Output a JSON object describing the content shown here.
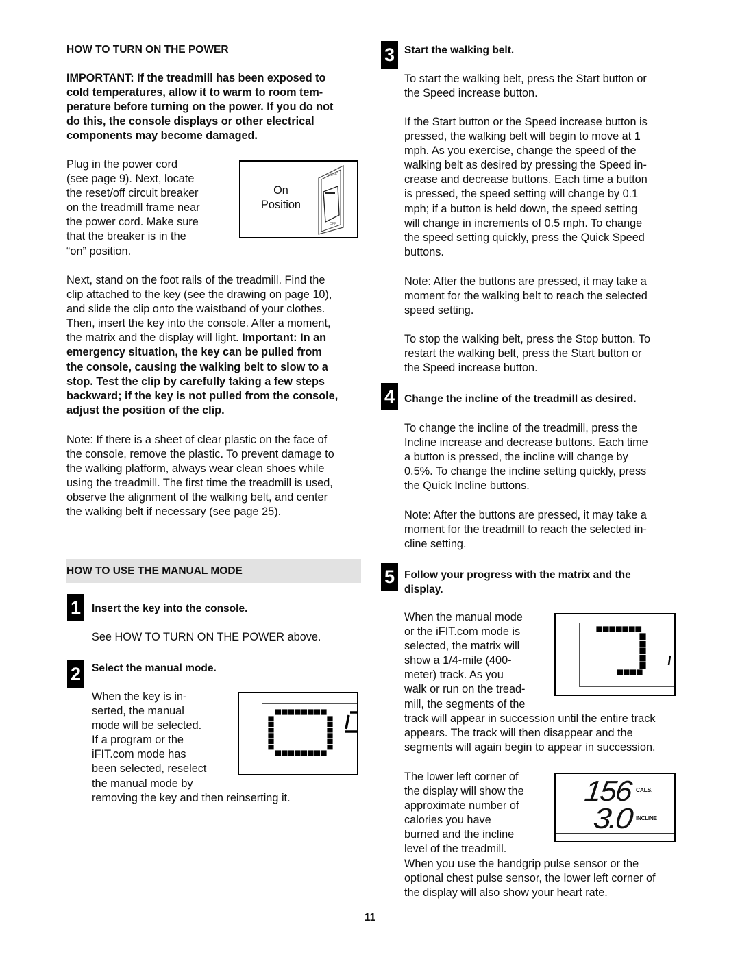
{
  "left": {
    "power_heading": "HOW TO TURN ON THE POWER",
    "important": "IMPORTANT: If the treadmill has been exposed to\ncold temperatures, allow it to warm to room tem-\nperature before turning on the power. If you do not\ndo this, the console displays or other electrical\ncomponents may become damaged.",
    "plug": "Plug in the power cord\n(see page 9). Next, locate\nthe reset/off circuit breaker\non the treadmill frame near\nthe power cord. Make sure\nthat the breaker is in the\n“on” position.",
    "switch_figure": {
      "label": "On\nPosition",
      "reset": "RESET",
      "off": "OFF"
    },
    "next_normal": "Next, stand on the foot rails of the treadmill. Find the\nclip attached to the key (see the drawing on page 10),\nand slide the clip onto the waistband of your clothes.\nThen, insert the key into the console. After a moment,\nthe matrix and the display will light. ",
    "next_bold": "Important: In an\nemergency situation, the key can be pulled from\nthe console, causing the walking belt to slow to a\nstop. Test the clip by carefully taking a few steps\nbackward; if the key is not pulled from the console,\nadjust the position of the clip.",
    "note": "Note: If there is a sheet of clear plastic on the face of\nthe console, remove the plastic. To prevent damage to\nthe walking platform, always wear clean shoes while\nusing the treadmill. The first time the treadmill is used,\nobserve the alignment of the walking belt, and center\nthe walking belt if necessary (see page 25).",
    "manual_heading": "HOW TO USE THE MANUAL MODE",
    "step1": {
      "num": "1",
      "title": "Insert the key into the console.",
      "text": "See HOW TO TURN ON THE POWER above."
    },
    "step2": {
      "num": "2",
      "title": "Select the manual mode.",
      "text": "When the key is in-\nserted, the manual\nmode will be selected.\nIf a program or the\niFIT.com mode has\nbeen selected, reselect\nthe manual mode by",
      "text2": "removing the key and then reinserting it."
    }
  },
  "right": {
    "step3": {
      "num": "3",
      "title": "Start the walking belt.",
      "p1": "To start the walking belt, press the Start button or\nthe Speed increase button.",
      "p2": "If the Start button or the Speed increase button is\npressed, the walking belt will begin to move at 1\nmph. As you exercise, change the speed of the\nwalking belt as desired by pressing the Speed in-\ncrease and decrease buttons. Each time a button\nis pressed, the speed setting will change by 0.1\nmph; if a button is held down, the speed setting\nwill change in increments of 0.5 mph. To change\nthe speed setting quickly, press the Quick Speed\nbuttons.",
      "p3": "Note: After the buttons are pressed, it may take a\nmoment for the walking belt to reach the selected\nspeed setting.",
      "p4": "To stop the walking belt, press the Stop button. To\nrestart the walking belt, press the Start button or\nthe Speed increase button."
    },
    "step4": {
      "num": "4",
      "title": "Change the incline of the treadmill as desired.",
      "p1": "To change the incline of the treadmill, press the\nIncline increase and decrease buttons. Each time\na button is pressed, the incline will change by\n0.5%. To change the incline setting quickly, press\nthe Quick Incline buttons.",
      "p2": "Note: After the buttons are pressed, it may take a\nmoment for the treadmill to reach the selected in-\ncline setting."
    },
    "step5": {
      "num": "5",
      "title": "Follow your progress with the matrix and the\ndisplay.",
      "p1": "When the manual mode\nor the iFIT.com mode is\nselected, the matrix will\nshow a 1/4-mile (400-\nmeter) track. As you\nwalk or run on the tread-\nmill, the segments of the",
      "p1b": "track will appear in succession until the entire track\nappears. The track will then disappear and the\nsegments will again begin to appear in succession.",
      "p2": "The lower left corner of\nthe display will show the\napproximate number of\ncalories you have\nburned and the incline\nlevel of the treadmill.",
      "p3": "When you use the handgrip pulse sensor or the\noptional chest pulse sensor, the lower left corner of\nthe display will also show your heart rate.",
      "display": {
        "calories": "156",
        "calories_label": "CALS.",
        "incline": "3.0",
        "incline_label": "INCLINE"
      }
    }
  },
  "page_number": "11"
}
